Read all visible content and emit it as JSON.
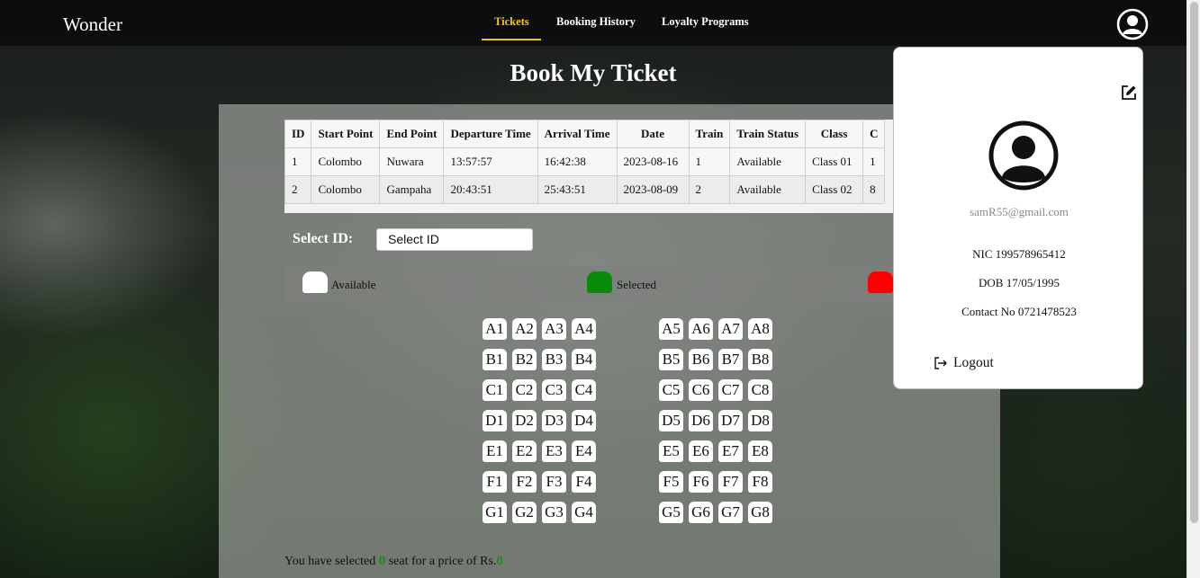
{
  "brand": "Wonder",
  "nav": {
    "tickets": "Tickets",
    "booking_history": "Booking History",
    "loyalty_programs": "Loyalty Programs"
  },
  "colors": {
    "accent": "#f5c518",
    "available": "#ffffff",
    "selected": "#0a8a0a",
    "booked": "#ff0000"
  },
  "page_title": "Book My Ticket",
  "table": {
    "headers": [
      "ID",
      "Start Point",
      "End Point",
      "Departure Time",
      "Arrival Time",
      "Date",
      "Train",
      "Train Status",
      "Class",
      "C"
    ],
    "rows": [
      [
        "1",
        "Colombo",
        "Nuwara",
        "13:57:57",
        "16:42:38",
        "2023-08-16",
        "1",
        "Available",
        "Class 01",
        "1"
      ],
      [
        "2",
        "Colombo",
        "Gampaha",
        "20:43:51",
        "25:43:51",
        "2023-08-09",
        "2",
        "Available",
        "Class 02",
        "8"
      ]
    ]
  },
  "select": {
    "label": "Select ID:",
    "value": "Select ID"
  },
  "legend": {
    "available": "Available",
    "selected": "Selected"
  },
  "seats": {
    "left": [
      [
        "A1",
        "A2",
        "A3",
        "A4"
      ],
      [
        "B1",
        "B2",
        "B3",
        "B4"
      ],
      [
        "C1",
        "C2",
        "C3",
        "C4"
      ],
      [
        "D1",
        "D2",
        "D3",
        "D4"
      ],
      [
        "E1",
        "E2",
        "E3",
        "E4"
      ],
      [
        "F1",
        "F2",
        "F3",
        "F4"
      ],
      [
        "G1",
        "G2",
        "G3",
        "G4"
      ]
    ],
    "right": [
      [
        "A5",
        "A6",
        "A7",
        "A8"
      ],
      [
        "B5",
        "B6",
        "B7",
        "B8"
      ],
      [
        "C5",
        "C6",
        "C7",
        "C8"
      ],
      [
        "D5",
        "D6",
        "D7",
        "D8"
      ],
      [
        "E5",
        "E6",
        "E7",
        "E8"
      ],
      [
        "F5",
        "F6",
        "F7",
        "F8"
      ],
      [
        "G5",
        "G6",
        "G7",
        "G8"
      ]
    ]
  },
  "summary": {
    "prefix": "You have selected",
    "count": "0",
    "middle": "seat for a price of Rs.",
    "price": "0"
  },
  "profile": {
    "email": "samR55@gmail.com",
    "nic": "NIC 199578965412",
    "dob": "DOB 17/05/1995",
    "contact": "Contact No 0721478523",
    "logout": "Logout"
  },
  "icons": {
    "avatar": "user-circle-icon",
    "edit": "edit-pencil-icon",
    "logout": "logout-arrow-icon"
  }
}
